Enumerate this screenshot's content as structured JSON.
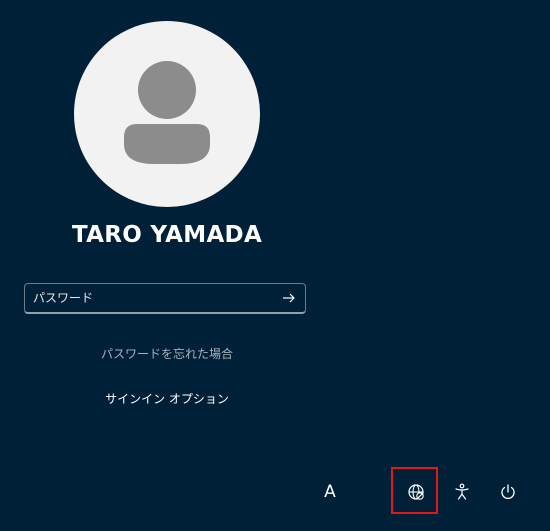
{
  "user": {
    "name": "TARO YAMADA"
  },
  "password": {
    "placeholder": "パスワード",
    "value": ""
  },
  "links": {
    "forgot_password": "パスワードを忘れた場合",
    "signin_options": "サインイン オプション"
  },
  "system_tray": {
    "language_label": "A"
  },
  "icons": {
    "avatar": "user-avatar-icon",
    "submit": "arrow-right-icon",
    "network": "globe-network-icon",
    "accessibility": "accessibility-icon",
    "power": "power-icon"
  },
  "colors": {
    "background": "#002038",
    "avatar_bg": "#f2f2f2",
    "avatar_figure": "#8c8c8c",
    "highlight": "#e0181c"
  }
}
